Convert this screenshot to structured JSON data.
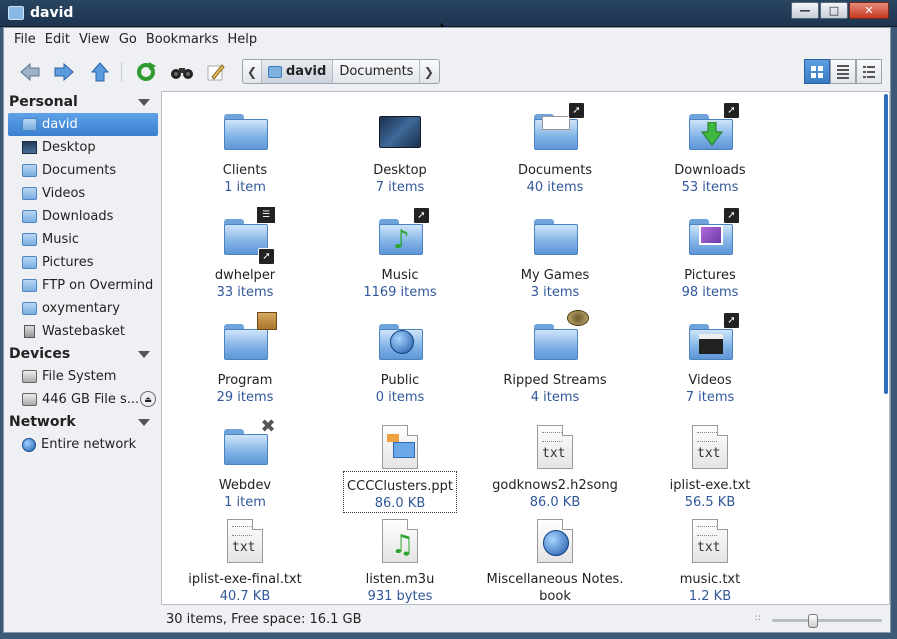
{
  "window": {
    "title": "david"
  },
  "menubar": [
    "File",
    "Edit",
    "View",
    "Go",
    "Bookmarks",
    "Help"
  ],
  "toolbar": {
    "buttons": [
      "back-icon",
      "forward-icon",
      "up-icon",
      "reload-icon",
      "find-icon",
      "edit-location-icon"
    ],
    "path": {
      "segments": [
        "david",
        "Documents"
      ],
      "active_index": 0
    },
    "views": [
      "icon-view-icon",
      "compact-view-icon",
      "list-view-icon"
    ],
    "active_view": 0
  },
  "sidebar": {
    "personal": {
      "title": "Personal",
      "items": [
        "david",
        "Desktop",
        "Documents",
        "Videos",
        "Downloads",
        "Music",
        "Pictures",
        "FTP on Overmind",
        "oxymentary",
        "Wastebasket"
      ]
    },
    "devices": {
      "title": "Devices",
      "items": [
        "File System",
        "446 GB File s..."
      ]
    },
    "network": {
      "title": "Network",
      "items": [
        "Entire network"
      ]
    }
  },
  "files": [
    {
      "name": "Clients",
      "meta": "1 item"
    },
    {
      "name": "Desktop",
      "meta": "7 items"
    },
    {
      "name": "Documents",
      "meta": "40 items"
    },
    {
      "name": "Downloads",
      "meta": "53 items"
    },
    {
      "name": "dwhelper",
      "meta": "33 items"
    },
    {
      "name": "Music",
      "meta": "1169 items"
    },
    {
      "name": "My Games",
      "meta": "3 items"
    },
    {
      "name": "Pictures",
      "meta": "98 items"
    },
    {
      "name": "Program",
      "meta": "29 items"
    },
    {
      "name": "Public",
      "meta": "0 items"
    },
    {
      "name": "Ripped Streams",
      "meta": "4 items"
    },
    {
      "name": "Videos",
      "meta": "7 items"
    },
    {
      "name": "Webdev",
      "meta": "1 item"
    },
    {
      "name": "CCCClusters.ppt",
      "meta": "86.0 KB"
    },
    {
      "name": "godknows2.h2song",
      "meta": "86.0 KB"
    },
    {
      "name": "iplist-exe.txt",
      "meta": "56.5 KB"
    },
    {
      "name": "iplist-exe-final.txt",
      "meta": "40.7 KB"
    },
    {
      "name": "listen.m3u",
      "meta": "931 bytes"
    },
    {
      "name": "Miscellaneous Notes.",
      "name2": "book"
    },
    {
      "name": "music.txt",
      "meta": "1.2 KB"
    }
  ],
  "file_badge": {
    "txt": "txt"
  },
  "statusbar": {
    "text": "30 items, Free space: 16.1 GB"
  }
}
